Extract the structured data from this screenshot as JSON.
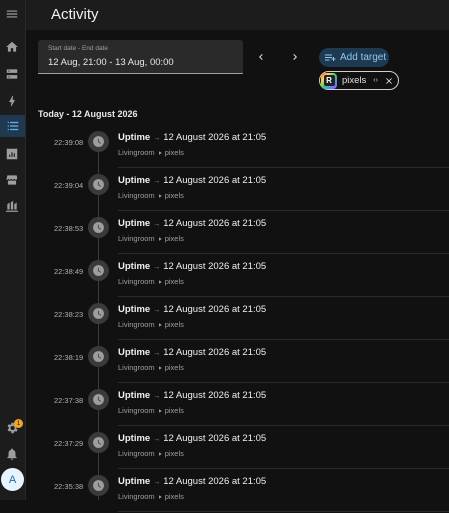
{
  "header": {
    "title": "Activity"
  },
  "date_picker": {
    "label": "Start date - End date",
    "value": "12 Aug, 21:00 - 13 Aug, 00:00"
  },
  "toolbar": {
    "add_target_label": "Add target"
  },
  "target_chip": {
    "label": "pixels",
    "logo_letter": "R",
    "expand_glyph": "‹›"
  },
  "sidebar": {
    "badge_count": "1",
    "avatar_initial": "A"
  },
  "day": {
    "label": "Today - 12 August 2026"
  },
  "entries": [
    {
      "time": "22:39:08",
      "name": "Uptime",
      "sep": "→",
      "value": "12 August 2026 at 21:05",
      "area": "Livingroom",
      "device": "pixels"
    },
    {
      "time": "22:39:04",
      "name": "Uptime",
      "sep": "→",
      "value": "12 August 2026 at 21:05",
      "area": "Livingroom",
      "device": "pixels"
    },
    {
      "time": "22:38:53",
      "name": "Uptime",
      "sep": "→",
      "value": "12 August 2026 at 21:05",
      "area": "Livingroom",
      "device": "pixels"
    },
    {
      "time": "22:38:49",
      "name": "Uptime",
      "sep": "→",
      "value": "12 August 2026 at 21:05",
      "area": "Livingroom",
      "device": "pixels"
    },
    {
      "time": "22:38:23",
      "name": "Uptime",
      "sep": "→",
      "value": "12 August 2026 at 21:05",
      "area": "Livingroom",
      "device": "pixels"
    },
    {
      "time": "22:38:19",
      "name": "Uptime",
      "sep": "→",
      "value": "12 August 2026 at 21:05",
      "area": "Livingroom",
      "device": "pixels"
    },
    {
      "time": "22:37:38",
      "name": "Uptime",
      "sep": "→",
      "value": "12 August 2026 at 21:05",
      "area": "Livingroom",
      "device": "pixels"
    },
    {
      "time": "22:37:29",
      "name": "Uptime",
      "sep": "→",
      "value": "12 August 2026 at 21:05",
      "area": "Livingroom",
      "device": "pixels"
    },
    {
      "time": "22:35:38",
      "name": "Uptime",
      "sep": "→",
      "value": "12 August 2026 at 21:05",
      "area": "Livingroom",
      "device": "pixels"
    }
  ],
  "colors": {
    "background": "#111111",
    "accent": "#6ab0e8",
    "badge": "#f5a623"
  }
}
